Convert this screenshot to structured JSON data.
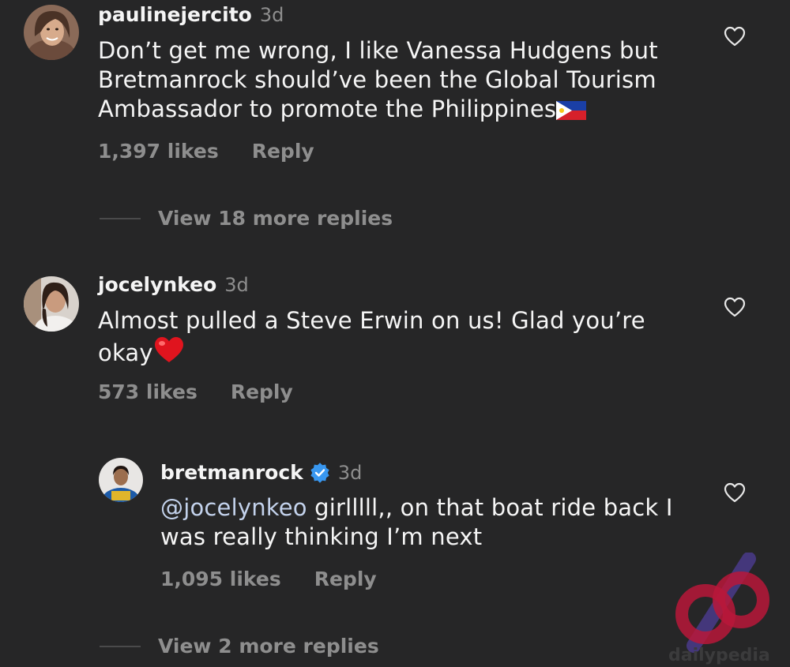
{
  "comments": [
    {
      "username": "paulinejercito",
      "time": "3d",
      "text": "Don’t get me wrong, I like Vanessa Hudgens but Bretmanrock should’ve been the Global Tourism Ambassador to promote the Philippines",
      "emoji": "philippines-flag",
      "likes": "1,397 likes",
      "reply_label": "Reply",
      "view_replies": "View 18 more replies"
    },
    {
      "username": "jocelynkeo",
      "time": "3d",
      "text": "Almost pulled a Steve Erwin on us! Glad you’re okay",
      "emoji": "red-heart",
      "likes": "573 likes",
      "reply_label": "Reply"
    },
    {
      "username": "bretmanrock",
      "verified": true,
      "time": "3d",
      "mention": "@jocelynkeo",
      "text": " girlllll,, on that boat ride back I was really thinking I’m next",
      "likes": "1,095 likes",
      "reply_label": "Reply",
      "view_replies": "View 2 more replies"
    }
  ],
  "watermark": {
    "text": "dailypedia"
  },
  "colors": {
    "background": "#262627",
    "primary_text": "#f5f5f5",
    "secondary_text": "#8e8e8e",
    "verified_blue": "#3897f0",
    "mention": "#c3d2ec"
  }
}
